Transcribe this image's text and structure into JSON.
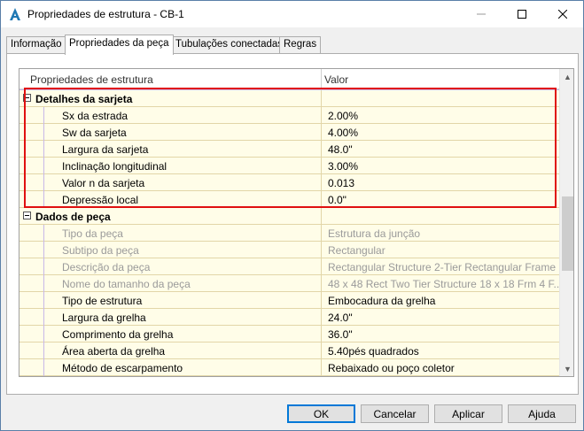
{
  "window": {
    "title": "Propriedades de estrutura - CB-1"
  },
  "tabs": [
    {
      "label": "Informação",
      "active": false
    },
    {
      "label": "Propriedades da peça",
      "active": true
    },
    {
      "label": "Tubulações conectadas",
      "active": false
    },
    {
      "label": "Regras",
      "active": false
    }
  ],
  "grid": {
    "headers": {
      "property": "Propriedades de estrutura",
      "value": "Valor"
    },
    "groups": [
      {
        "label": "Detalhes da sarjeta",
        "rows": [
          {
            "name": "Sx da estrada",
            "value": "2.00%"
          },
          {
            "name": "Sw da sarjeta",
            "value": "4.00%"
          },
          {
            "name": "Largura da sarjeta",
            "value": "48.0\""
          },
          {
            "name": "Inclinação longitudinal",
            "value": "3.00%"
          },
          {
            "name": "Valor n da sarjeta",
            "value": "0.013"
          },
          {
            "name": "Depressão local",
            "value": "0.0\""
          }
        ]
      },
      {
        "label": "Dados de peça",
        "rows": [
          {
            "name": "Tipo da peça",
            "value": "Estrutura da junção"
          },
          {
            "name": "Subtipo da peça",
            "value": "Rectangular"
          },
          {
            "name": "Descrição da peça",
            "value": "Rectangular Structure 2-Tier Rectangular Frame"
          },
          {
            "name": "Nome do tamanho da peça",
            "value": "48 x 48 Rect Two Tier Structure 18 x 18 Frm 4 F..."
          },
          {
            "name": "Tipo de estrutura",
            "value": "Embocadura da grelha"
          },
          {
            "name": "Largura da grelha",
            "value": "24.0\""
          },
          {
            "name": "Comprimento da grelha",
            "value": "36.0\""
          },
          {
            "name": "Área aberta da grelha",
            "value": "5.40pés quadrados"
          },
          {
            "name": "Método de escarpamento",
            "value": "Rebaixado ou poço coletor"
          }
        ]
      }
    ]
  },
  "buttons": {
    "ok": "OK",
    "cancel": "Cancelar",
    "apply": "Aplicar",
    "help": "Ajuda"
  },
  "colors": {
    "highlight": "#e01010",
    "row_bg": "#fffde8",
    "accent": "#0078d7"
  }
}
